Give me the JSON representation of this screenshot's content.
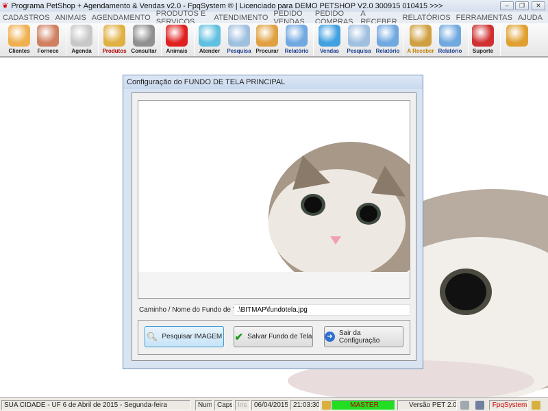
{
  "window": {
    "title": "Programa PetShop + Agendamento & Vendas v2.0 - FpqSystem ® | Licenciado para  DEMO PETSHOP V2.0 300915 010415 >>>",
    "minimize": "–",
    "restore": "❐",
    "close": "✕"
  },
  "menu": [
    "CADASTROS",
    "ANIMAIS",
    "AGENDAMENTO",
    "PRODUTOS E SERVIÇOS",
    "ATENDIMENTO",
    "PEDIDO VENDAS",
    "PEDIDO COMPRAS",
    "A RECEBER",
    "RELATÓRIOS",
    "FERRAMENTAS",
    "AJUDA"
  ],
  "toolbar": [
    {
      "label": "Clientes",
      "icon": "users-icon",
      "color": "#f0b050"
    },
    {
      "label": "Fornece",
      "icon": "supplier-person-icon",
      "color": "#d08060"
    },
    {
      "label": "Agenda",
      "icon": "calendar-clock-icon",
      "color": "#c8c8c8"
    },
    {
      "label": "Produtos",
      "icon": "boxes-icon",
      "color": "#e0b040",
      "labelColor": "#b00000"
    },
    {
      "label": "Consultar",
      "icon": "barcode-icon",
      "color": "#909090"
    },
    {
      "label": "Animais",
      "icon": "paw-red-icon",
      "color": "#e02020"
    },
    {
      "label": "Atender",
      "icon": "paw-cross-icon",
      "color": "#60c0e0"
    },
    {
      "label": "Pesquisa",
      "icon": "document-search-icon",
      "color": "#a0c0e0",
      "labelColor": "#1a3c8c"
    },
    {
      "label": "Procurar",
      "icon": "file-drawer-icon",
      "color": "#e0a040"
    },
    {
      "label": "Relatório",
      "icon": "printer-report-icon",
      "color": "#70a8e0",
      "labelColor": "#1a3c8c"
    },
    {
      "label": "Vendas",
      "icon": "monitor-icon",
      "color": "#40a0e0",
      "labelColor": "#1a3c8c"
    },
    {
      "label": "Pesquisa",
      "icon": "document-search-icon",
      "color": "#a0c0e0",
      "labelColor": "#1a3c8c"
    },
    {
      "label": "Relatório",
      "icon": "printer-report-icon",
      "color": "#70a8e0",
      "labelColor": "#1a3c8c"
    },
    {
      "label": "A Receber",
      "icon": "money-icon",
      "color": "#d0a040",
      "labelColor": "#c08000"
    },
    {
      "label": "Relatório",
      "icon": "printer-report-icon",
      "color": "#70a8e0",
      "labelColor": "#1a3c8c"
    },
    {
      "label": "Suporte",
      "icon": "support-headset-icon",
      "color": "#d03030"
    },
    {
      "label": "",
      "icon": "exit-door-icon",
      "color": "#e0a030"
    }
  ],
  "dialog": {
    "title": "Configuração do FUNDO DE TELA PRINCIPAL",
    "path_label": "Caminho / Nome do Fundo de Tela",
    "path_value": ".\\BITMAP\\fundotela.jpg",
    "btn_search": "Pesquisar IMAGEM",
    "btn_save": "Salvar Fundo de Tela",
    "btn_exit": "Sair da Configuração"
  },
  "status": {
    "location": "SUA CIDADE - UF  6 de Abril de 2015 - Segunda-feira",
    "num": "Num",
    "caps": "Caps",
    "ins": "Ins",
    "date": "06/04/2015",
    "time": "21:03:30",
    "user": "MASTER",
    "version": "Versão PET 2.0",
    "brand": "FpqSystem",
    "user_color": "#22dd22"
  }
}
